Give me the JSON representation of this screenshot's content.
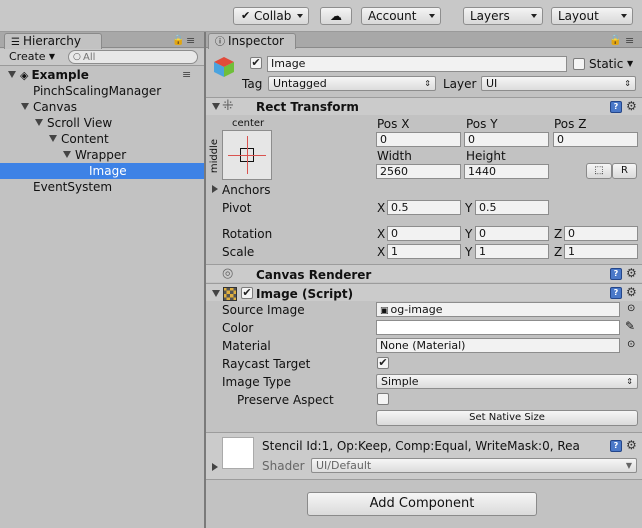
{
  "toolbar": {
    "collab": "Collab",
    "account": "Account",
    "layers": "Layers",
    "layout": "Layout"
  },
  "hierarchy": {
    "tab": "Hierarchy",
    "create": "Create",
    "search_placeholder": "All",
    "scene": "Example",
    "items": [
      {
        "label": "PinchScalingManager"
      },
      {
        "label": "Canvas"
      },
      {
        "label": "Scroll View"
      },
      {
        "label": "Content"
      },
      {
        "label": "Wrapper"
      },
      {
        "label": "Image"
      },
      {
        "label": "EventSystem"
      }
    ]
  },
  "inspector": {
    "tab": "Inspector",
    "object_name": "Image",
    "static_label": "Static",
    "tag_label": "Tag",
    "tag_value": "Untagged",
    "layer_label": "Layer",
    "layer_value": "UI",
    "rect": {
      "title": "Rect Transform",
      "anchor_h": "center",
      "anchor_v": "middle",
      "posx_label": "Pos X",
      "posy_label": "Pos Y",
      "posz_label": "Pos Z",
      "posx": "0",
      "posy": "0",
      "posz": "0",
      "width_label": "Width",
      "height_label": "Height",
      "width": "2560",
      "height": "1440",
      "r_button": "R",
      "anchors_label": "Anchors",
      "pivot_label": "Pivot",
      "pivot_x": "0.5",
      "pivot_y": "0.5",
      "rotation_label": "Rotation",
      "rot_x": "0",
      "rot_y": "0",
      "rot_z": "0",
      "scale_label": "Scale",
      "scale_x": "1",
      "scale_y": "1",
      "scale_z": "1",
      "x": "X",
      "y": "Y",
      "z": "Z"
    },
    "canvas_renderer": {
      "title": "Canvas Renderer"
    },
    "image_script": {
      "title": "Image (Script)",
      "source_image_label": "Source Image",
      "source_image": "og-image",
      "color_label": "Color",
      "material_label": "Material",
      "material": "None (Material)",
      "raycast_label": "Raycast Target",
      "image_type_label": "Image Type",
      "image_type": "Simple",
      "preserve_label": "Preserve Aspect",
      "set_native": "Set Native Size"
    },
    "material_preview": {
      "stencil": "Stencil Id:1, Op:Keep, Comp:Equal, WriteMask:0, Rea",
      "shader_label": "Shader",
      "shader_value": "UI/Default"
    },
    "add_component": "Add Component"
  }
}
